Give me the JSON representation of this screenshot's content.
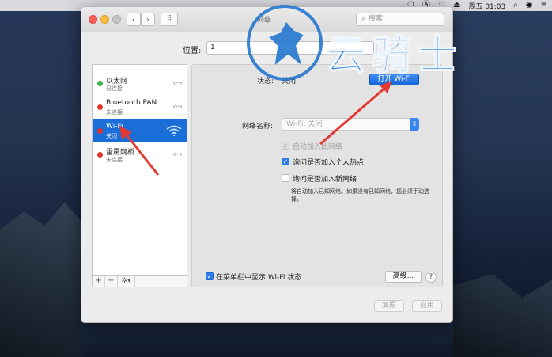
{
  "menubar": {
    "datetime": "周五 01:03",
    "icons": [
      "app-o-icon",
      "a-icon",
      "heart-icon",
      "eject-icon",
      "search-icon",
      "user-icon",
      "list-icon"
    ]
  },
  "window": {
    "title": "网络",
    "search_placeholder": "搜索"
  },
  "location": {
    "label": "位置:",
    "value": "1"
  },
  "services": [
    {
      "name": "以太网",
      "status": "已连接",
      "dot": "green",
      "icon": "ethernet-icon"
    },
    {
      "name": "Bluetooth PAN",
      "status": "未连接",
      "dot": "red",
      "icon": "bluetooth-icon"
    },
    {
      "name": "Wi-Fi",
      "status": "关闭",
      "dot": "red",
      "icon": "wifi-icon",
      "selected": true
    },
    {
      "name": "雷雳网桥",
      "status": "未连接",
      "dot": "red",
      "icon": "thunderbolt-icon"
    }
  ],
  "sidebar_buttons": {
    "add": "+",
    "remove": "−",
    "gear": "✲▾"
  },
  "detail": {
    "status_label": "状态:",
    "status_value": "关闭",
    "wifi_on_button": "打开 Wi-Fi",
    "network_name_label": "网络名称:",
    "network_name_value": "Wi-Fi: 关闭",
    "auto_join": {
      "label": "自动加入此网络",
      "checked": true,
      "disabled": true
    },
    "ask_hotspot": {
      "label": "询问是否加入个人热点",
      "checked": true
    },
    "ask_new": {
      "label": "询问是否加入新网络",
      "checked": false
    },
    "hint": "将自动加入已知网络。如果没有已知网络，您必须手动选择。",
    "menubar_status": {
      "label": "在菜单栏中显示 Wi-Fi 状态",
      "checked": true
    },
    "advanced_button": "高级...",
    "help_button": "?"
  },
  "footer": {
    "revert": "复原",
    "apply": "应用"
  },
  "watermark": {
    "text": "云骑士"
  }
}
